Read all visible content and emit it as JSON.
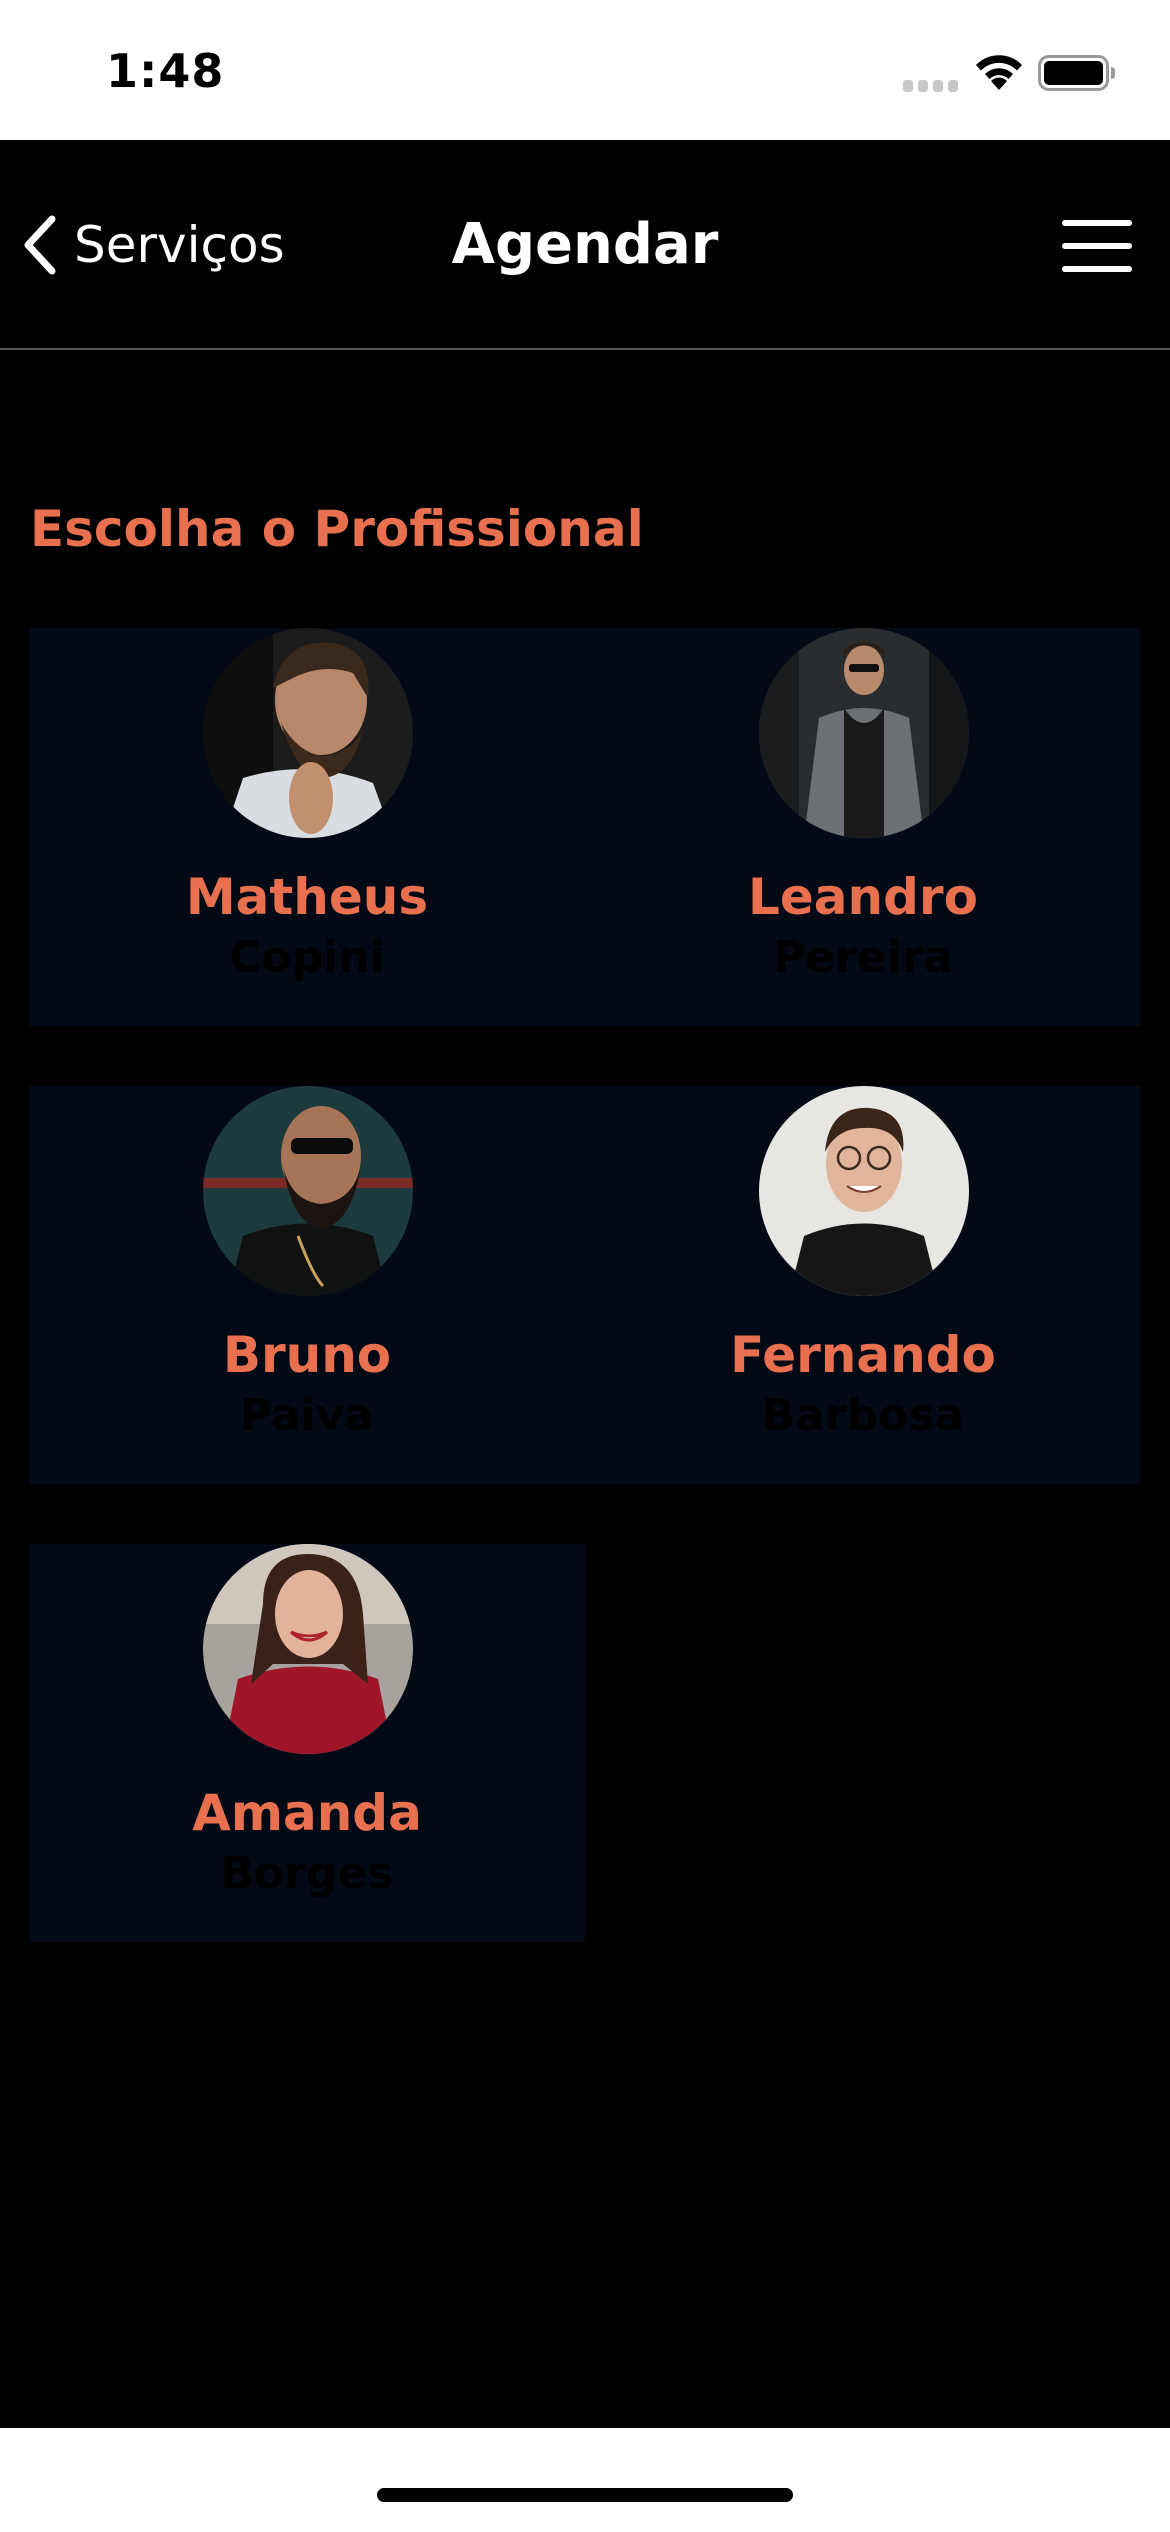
{
  "status_bar": {
    "time": "1:48",
    "icons": [
      "cellular-signal-icon",
      "wifi-icon",
      "battery-icon"
    ]
  },
  "nav": {
    "back_label": "Serviços",
    "title": "Agendar",
    "back_icon": "chevron-left-icon",
    "menu_icon": "hamburger-menu-icon"
  },
  "section": {
    "title": "Escolha o Profissional"
  },
  "professionals": [
    {
      "first_name": "Matheus",
      "last_name": "Copini"
    },
    {
      "first_name": "Leandro",
      "last_name": "Pereira"
    },
    {
      "first_name": "Bruno",
      "last_name": "Paiva"
    },
    {
      "first_name": "Fernando",
      "last_name": "Barbosa"
    },
    {
      "first_name": "Amanda",
      "last_name": "Borges"
    }
  ],
  "colors": {
    "accent": "#e8704f",
    "background": "#000000",
    "card_background": "#030a16",
    "header_text": "#ffffff"
  }
}
